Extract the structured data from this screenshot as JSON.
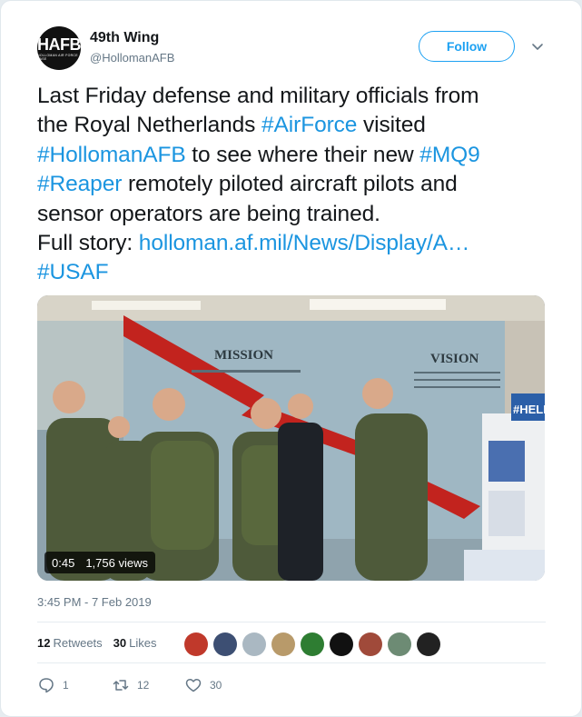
{
  "user": {
    "name": "49th Wing",
    "handle": "@HollomanAFB",
    "avatar_logo": "HAFB",
    "avatar_logo_sub": "Holloman Air Force Base"
  },
  "follow_label": "Follow",
  "tweet": {
    "line1": "Last Friday defense and military officials from",
    "line2_pre": "the Royal Netherlands ",
    "line2_tag": "#AirForce",
    "line2_post": " visited",
    "line3_tag1": "#HollomanAFB",
    "line3_mid": " to see where their new ",
    "line3_tag2": "#MQ9",
    "line4_tag": "#Reaper",
    "line4_post": " remotely piloted aircraft pilots and",
    "line5": "sensor operators are being trained.",
    "line6_pre": "Full story: ",
    "line6_link": "holloman.af.mil/News/Display/A…",
    "line7_tag": "#USAF"
  },
  "video": {
    "duration": "0:45",
    "views": "1,756 views",
    "sign_mission": "MISSION",
    "sign_vision": "VISION",
    "sign_help": "#HELPF"
  },
  "timestamp": "3:45 PM - 7 Feb 2019",
  "stats": {
    "retweets_count": "12",
    "retweets_label": "Retweets",
    "likes_count": "30",
    "likes_label": "Likes"
  },
  "likers": [
    {
      "color": "#c0392b"
    },
    {
      "color": "#3d4f73"
    },
    {
      "color": "#aab8c2"
    },
    {
      "color": "#b89a6a"
    },
    {
      "color": "#2e7d32"
    },
    {
      "color": "#111111"
    },
    {
      "color": "#a04a3a"
    },
    {
      "color": "#6d8b74"
    },
    {
      "color": "#222222"
    }
  ],
  "actions": {
    "reply_count": "1",
    "retweet_count": "12",
    "like_count": "30"
  },
  "colors": {
    "accent": "#1da1f2",
    "link": "#1b95e0",
    "muted": "#657786"
  },
  "icons": {
    "caret": "chevron-down-icon",
    "reply": "reply-icon",
    "retweet": "retweet-icon",
    "like": "heart-icon"
  }
}
